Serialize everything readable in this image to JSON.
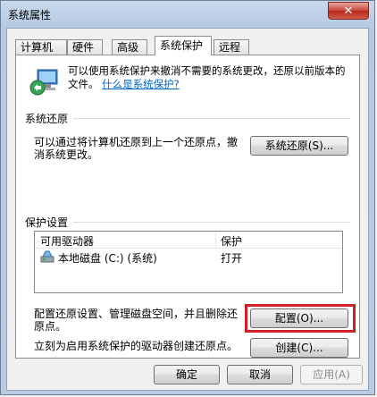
{
  "window": {
    "title": "系统属性",
    "close_glyph": "✕"
  },
  "tabs": [
    {
      "label": "计算机名"
    },
    {
      "label": "硬件"
    },
    {
      "label": "高级"
    },
    {
      "label": "系统保护",
      "active": true
    },
    {
      "label": "远程"
    }
  ],
  "intro": {
    "text": "可以使用系统保护来撤消不需要的系统更改，还原以前版本的文件。",
    "link": "什么是系统保护?"
  },
  "restore": {
    "group_title": "系统还原",
    "description": "可以通过将计算机还原到上一个还原点，撤消系统更改。",
    "button": "系统还原(S)..."
  },
  "protection": {
    "group_title": "保护设置",
    "columns": [
      "可用驱动器",
      "保护"
    ],
    "rows": [
      {
        "drive": "本地磁盘 (C:) (系统)",
        "status": "打开"
      }
    ],
    "configure_text": "配置还原设置、管理磁盘空间，并且删除还原点。",
    "configure_button": "配置(O)...",
    "create_text": "立刻为启用系统保护的驱动器创建还原点。",
    "create_button": "创建(C)..."
  },
  "footer": {
    "ok": "确定",
    "cancel": "取消",
    "apply": "应用(A)"
  },
  "colors": {
    "highlight": "#d01f25",
    "link": "#0066cc"
  }
}
